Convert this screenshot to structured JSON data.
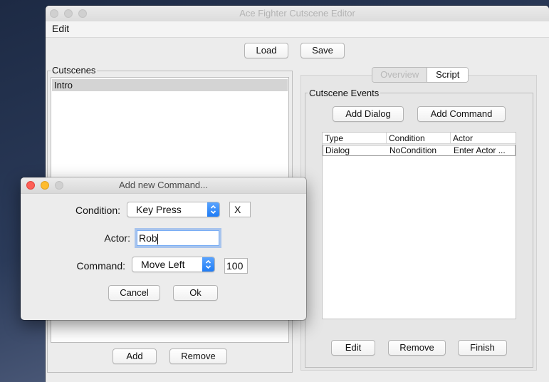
{
  "main_window": {
    "title": "Ace Fighter Cutscene Editor",
    "menu": {
      "edit": "Edit"
    },
    "toolbar": {
      "load": "Load",
      "save": "Save"
    },
    "cutscenes": {
      "title": "Cutscenes",
      "items": [
        "Intro"
      ],
      "add": "Add",
      "remove": "Remove"
    },
    "tabs": [
      {
        "label": "Overview",
        "active": false
      },
      {
        "label": "Script",
        "active": true
      }
    ],
    "events": {
      "title": "Cutscene Events",
      "add_dialog": "Add Dialog",
      "add_command": "Add Command",
      "columns": [
        "Type",
        "Condition",
        "Actor"
      ],
      "rows": [
        {
          "type": "Dialog",
          "condition": "NoCondition",
          "actor": "Enter Actor ..."
        }
      ],
      "edit": "Edit",
      "remove": "Remove",
      "finish": "Finish"
    }
  },
  "dialog": {
    "title": "Add new Command...",
    "condition_label": "Condition:",
    "condition_value": "Key Press",
    "condition_key": "X",
    "actor_label": "Actor:",
    "actor_value": "Rob",
    "command_label": "Command:",
    "command_value": "Move Left",
    "command_amount": "100",
    "cancel": "Cancel",
    "ok": "Ok"
  },
  "colors": {
    "accent": "#1f7cf5",
    "close": "#fe5f57",
    "minimize": "#febc2e"
  }
}
